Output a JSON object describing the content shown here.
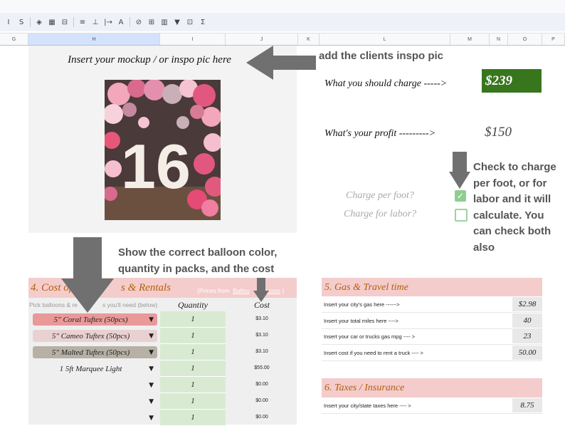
{
  "toolbar": {
    "icons": [
      "italic-icon",
      "strikethrough-icon",
      "fill-color-icon",
      "borders-icon",
      "merge-icon",
      "align-icon",
      "valign-icon",
      "wrap-icon",
      "rotate-icon",
      "link-icon",
      "comment-icon",
      "chart-icon",
      "filter-icon",
      "functions-icon",
      "sigma-icon"
    ],
    "glyphs": [
      "I",
      "S",
      "◈",
      "▦",
      "⊟",
      "≡",
      "⊥",
      "|→",
      "A",
      "⊘",
      "⊞",
      "▥",
      "▼",
      "⊡",
      "Σ"
    ]
  },
  "columns": [
    "G",
    "H",
    "I",
    "J",
    "K",
    "L",
    "M",
    "N",
    "O",
    "P"
  ],
  "mockup": {
    "heading": "Insert your mockup / or inspo pic here",
    "photo_number": "16"
  },
  "callouts": {
    "inspo": "add the clients inspo pic",
    "balloon_line1": "Show the correct balloon color,",
    "balloon_line2": "quantity in packs, and the cost",
    "check_line1": "Check to charge",
    "check_line2": "per foot, or for",
    "check_line3": "labor and it will",
    "check_line4": "calculate. You",
    "check_line5": "can check both",
    "check_line6": "also"
  },
  "pricing": {
    "charge_label": "What you should charge ----->",
    "charge_value": "$239",
    "profit_label": "What's your profit --------->",
    "profit_value": "$150",
    "per_foot_label": "Charge per foot?",
    "per_foot_checked": true,
    "labor_label": "Charge for labor?",
    "labor_checked": false
  },
  "cost_section": {
    "title_a": "4. Cost of",
    "title_b": "s & Rentals",
    "prices_from_a": "(Prices from",
    "prices_from_link_a": "Balloo",
    "prices_from_link_b": "e.com",
    "prices_from_b": ")",
    "pick_a": "Pick balloons & re",
    "pick_b": "s you'll need (below)",
    "quantity_header": "Quantity",
    "cost_header": "Cost",
    "rows": [
      {
        "item": "5\" Coral Tuftex (50pcs)",
        "qty": "1",
        "cost": "$3.10",
        "color": "#ea9999"
      },
      {
        "item": "5\" Cameo Tuftex (50pcs)",
        "qty": "1",
        "cost": "$3.10",
        "color": "#ead1d1"
      },
      {
        "item": "5\" Malted Tuftex (50pcs)",
        "qty": "1",
        "cost": "$3.10",
        "color": "#b7b1a5"
      },
      {
        "item": "1 5ft Marquee Light",
        "qty": "1",
        "cost": "$55.00",
        "color": "#efefef"
      },
      {
        "item": "",
        "qty": "1",
        "cost": "$0.00",
        "color": "#efefef"
      },
      {
        "item": "",
        "qty": "1",
        "cost": "$0.00",
        "color": "#efefef"
      },
      {
        "item": "",
        "qty": "1",
        "cost": "$0.00",
        "color": "#efefef"
      }
    ]
  },
  "gas_section": {
    "title": "5. Gas & Travel time",
    "rows": [
      {
        "label": "Insert your city's gas here ------>",
        "value": "$2.98"
      },
      {
        "label": "Insert your total miles here ---->",
        "value": "40"
      },
      {
        "label": "Insert your car or trucks gas mpg ---- >",
        "value": "23"
      },
      {
        "label": "Insert cost if you need to rent a truck ---- >",
        "value": "50.00"
      }
    ]
  },
  "tax_section": {
    "title": "6.  Taxes / Insurance",
    "rows": [
      {
        "label": "Insert your city/state taxes here ---- >",
        "value": "8.75"
      }
    ]
  },
  "colors": {
    "charge_bg": "#38761d",
    "pink": "#f4cccc",
    "green_cell": "#d9ead3",
    "arrow": "#707070",
    "section_title": "#b45f06"
  }
}
